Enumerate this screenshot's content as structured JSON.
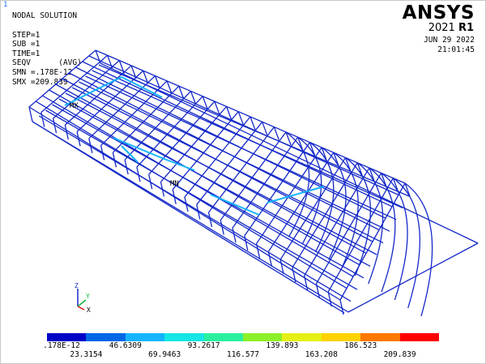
{
  "window": {
    "number": "1"
  },
  "header": {
    "title": "NODAL SOLUTION",
    "step": "STEP=1",
    "sub": "SUB =1",
    "time": "TIME=1",
    "result": "SEQV",
    "avg": "(AVG)",
    "smn": "SMN =.178E-12",
    "smx": "SMX =209.839"
  },
  "logo": {
    "brand": "ANSYS",
    "version_year": "2021",
    "version_rel": "R1"
  },
  "timestamp": {
    "date": "JUN 29 2022",
    "time": "21:01:45"
  },
  "markers": {
    "max": "MX",
    "min": "MN"
  },
  "triad": {
    "z": "Z",
    "y": "Y",
    "x": "X"
  },
  "legend": {
    "colors": [
      "#0000c8",
      "#0068e6",
      "#14b4ff",
      "#14e6e6",
      "#28f0a0",
      "#8cf028",
      "#e6f014",
      "#ffd200",
      "#ff7800",
      "#ff0000"
    ],
    "upper_labels": [
      ".178E-12",
      "46.6309",
      "93.2617",
      "139.893",
      "186.523"
    ],
    "lower_labels": [
      "23.3154",
      "69.9463",
      "116.577",
      "163.208",
      "209.839"
    ]
  }
}
